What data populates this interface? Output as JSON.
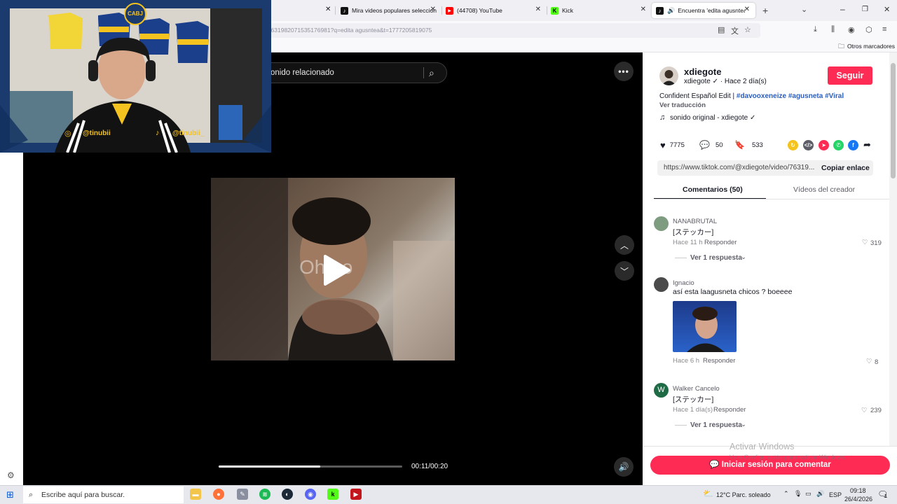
{
  "browser": {
    "tabs": [
      {
        "label": "Mira videos populares seleccion",
        "icon": "tiktok-icon"
      },
      {
        "label": "(44708) YouTube",
        "icon": "youtube-icon"
      },
      {
        "label": "Kick",
        "icon": "kick-icon"
      },
      {
        "label": "Encuentra 'edita agusntea'",
        "icon": "tiktok-icon"
      }
    ],
    "url": "eo/7631982071535176981?q=edita agusntea&t=1777205819075",
    "bookmarks_label": "Otros marcadores"
  },
  "player": {
    "search_text": "onido relacionado",
    "overlay_text": "Oh no",
    "time_current": "00:11",
    "time_total": "00:20",
    "time_display": "00:11/00:20",
    "progress": 0.555
  },
  "webcam": {
    "badge": "CABJ",
    "handle_left": "@tinubii",
    "handle_right": "@tinubii_"
  },
  "post": {
    "username": "xdiegote",
    "subline": "xdiegote ✓ · Hace 2 día(s)",
    "follow_label": "Seguir",
    "caption_prefix": "Confident Español Edit |",
    "hashtags": [
      "#davooxeneize",
      "#agusneta",
      "#Viral"
    ],
    "translate_label": "Ver traducción",
    "sound": "sonido original - xdiegote ✓",
    "likes": "7775",
    "comments": "50",
    "saves": "533",
    "link": "https://www.tiktok.com/@xdiegote/video/76319...",
    "copy_label": "Copiar enlace"
  },
  "tabs": {
    "comments": "Comentarios (50)",
    "creator": "Vídeos del creador"
  },
  "comments": [
    {
      "name": "NANABRUTAL",
      "text": "[ステッカー]",
      "time": "Hace 11 h",
      "reply": "Responder",
      "likes": "319",
      "replies": "Ver 1 respuesta"
    },
    {
      "name": "Ignacio",
      "text": "así esta laagusneta chicos ? boeeee",
      "time": "Hace 6 h",
      "reply": "Responder",
      "likes": "8"
    },
    {
      "name": "Walker Cancelo",
      "initial": "W",
      "text": "[ステッカー]",
      "time": "Hace 1 día(s)",
      "reply": "Responder",
      "likes": "239",
      "replies": "Ver 1 respuesta"
    }
  ],
  "login_label": "Iniciar sesión para comentar",
  "windows_watermark": {
    "title": "Activar Windows",
    "subtitle": "Ve a Configuración para activar Windows."
  },
  "taskbar": {
    "search_placeholder": "Escribe aquí para buscar.",
    "weather": "12°C  Parc. soleado",
    "lang": "ESP",
    "time": "09:18",
    "date": "26/4/2026",
    "notifications": "1"
  },
  "colors": {
    "accent": "#fe2c55",
    "hashtag": "#2b5db9",
    "boca_blue": "#1b3a6d",
    "boca_gold": "#f4c320"
  }
}
